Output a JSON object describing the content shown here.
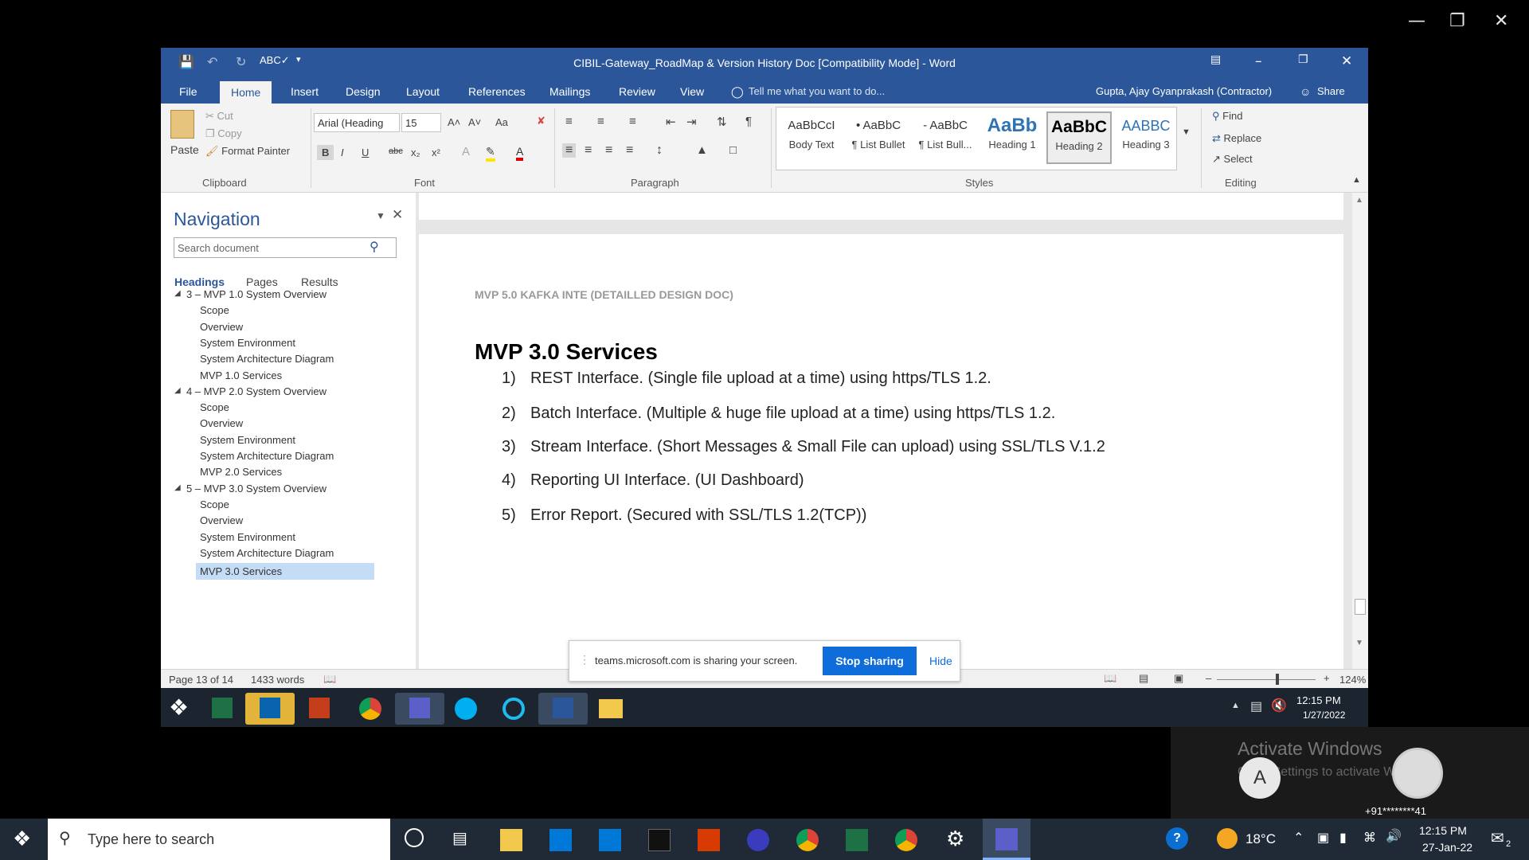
{
  "window": {
    "title": "CIBIL-Gateway_RoadMap & Version History Doc [Compatibility Mode] - Word",
    "user": "Gupta, Ajay Gyanprakash (Contractor)",
    "share": "Share"
  },
  "tabs": [
    "File",
    "Home",
    "Insert",
    "Design",
    "Layout",
    "References",
    "Mailings",
    "Review",
    "View"
  ],
  "tell_me": "Tell me what you want to do...",
  "clipboard": {
    "paste": "Paste",
    "cut": "Cut",
    "copy": "Copy",
    "format_painter": "Format Painter",
    "label": "Clipboard"
  },
  "font": {
    "name": "Arial (Heading",
    "size": "15",
    "label": "Font",
    "bold": "B",
    "italic": "I",
    "underline": "U",
    "aa": "Aa"
  },
  "paragraph_label": "Paragraph",
  "styles": {
    "label": "Styles",
    "items": [
      {
        "preview": "AaBbCcI",
        "name": "Body Text"
      },
      {
        "preview": "• AaBbC",
        "name": "¶ List Bullet"
      },
      {
        "preview": "- AaBbC",
        "name": "¶ List Bull..."
      },
      {
        "preview": "AaBb",
        "name": "Heading 1"
      },
      {
        "preview": "AaBbC",
        "name": "Heading 2"
      },
      {
        "preview": "AABBC",
        "name": "Heading 3"
      }
    ]
  },
  "editing": {
    "find": "Find",
    "replace": "Replace",
    "select": "Select",
    "label": "Editing"
  },
  "navigation": {
    "title": "Navigation",
    "search_placeholder": "Search document",
    "tabs": [
      "Headings",
      "Pages",
      "Results"
    ],
    "items": [
      {
        "text": "3 – MVP 1.0 System Overview",
        "level": 1
      },
      {
        "text": "Scope",
        "level": 2
      },
      {
        "text": "Overview",
        "level": 2
      },
      {
        "text": "System Environment",
        "level": 2
      },
      {
        "text": "System Architecture Diagram",
        "level": 2
      },
      {
        "text": "MVP 1.0 Services",
        "level": 2
      },
      {
        "text": "4 – MVP 2.0 System Overview",
        "level": 1
      },
      {
        "text": "Scope",
        "level": 2
      },
      {
        "text": "Overview",
        "level": 2
      },
      {
        "text": "System Environment",
        "level": 2
      },
      {
        "text": "System Architecture Diagram",
        "level": 2
      },
      {
        "text": "MVP 2.0 Services",
        "level": 2
      },
      {
        "text": "5 – MVP 3.0 System Overview",
        "level": 1
      },
      {
        "text": "Scope",
        "level": 2
      },
      {
        "text": "Overview",
        "level": 2
      },
      {
        "text": "System Environment",
        "level": 2
      },
      {
        "text": "System Architecture Diagram",
        "level": 2
      },
      {
        "text": "MVP 3.0 Services",
        "level": 2,
        "selected": true
      }
    ]
  },
  "document": {
    "header": "MVP 5.0 KAFKA INTE (DETAILLED DESIGN DOC)",
    "heading": "MVP 3.0 Services",
    "items": [
      {
        "num": "1)",
        "text": "REST Interface. (Single file upload at a time) using https/TLS 1.2."
      },
      {
        "num": "2)",
        "text": "Batch Interface. (Multiple & huge file upload at a time) using https/TLS 1.2."
      },
      {
        "num": "3)",
        "text": "Stream Interface. (Short Messages & Small File can upload) using SSL/TLS V.1.2"
      },
      {
        "num": "4)",
        "text": "Reporting UI Interface. (UI Dashboard)"
      },
      {
        "num": "5)",
        "text": "Error Report. (Secured with SSL/TLS 1.2(TCP))"
      }
    ]
  },
  "status": {
    "page": "Page 13 of 14",
    "words": "1433 words",
    "zoom": "124%",
    "zoom_level": 0.6
  },
  "share_bar": {
    "message": "teams.microsoft.com is sharing your screen.",
    "stop": "Stop sharing",
    "hide": "Hide"
  },
  "inner_clock": {
    "time": "12:15 PM",
    "date": "1/27/2022"
  },
  "activate": {
    "title": "Activate Windows",
    "subtitle": "Go to Settings to activate Windows.",
    "avatar": "A",
    "phone": "+91********41"
  },
  "taskbar": {
    "search_placeholder": "Type here to search",
    "temp": "18°C",
    "time": "12:15 PM",
    "date": "27-Jan-22",
    "badge": "2"
  },
  "colors": {
    "word_blue": "#2b579a",
    "teams_stop": "#0f6cdb",
    "nav_selected": "#c5dcf7"
  }
}
